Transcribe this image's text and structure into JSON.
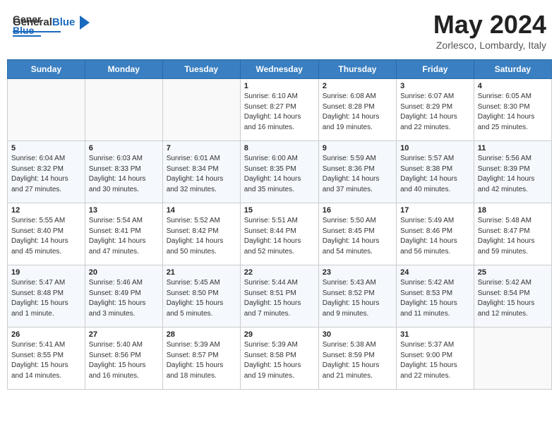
{
  "header": {
    "logo_general": "General",
    "logo_blue": "Blue",
    "title": "May 2024",
    "location": "Zorlesco, Lombardy, Italy"
  },
  "calendar": {
    "days_of_week": [
      "Sunday",
      "Monday",
      "Tuesday",
      "Wednesday",
      "Thursday",
      "Friday",
      "Saturday"
    ],
    "weeks": [
      [
        {
          "day": "",
          "info": ""
        },
        {
          "day": "",
          "info": ""
        },
        {
          "day": "",
          "info": ""
        },
        {
          "day": "1",
          "info": "Sunrise: 6:10 AM\nSunset: 8:27 PM\nDaylight: 14 hours\nand 16 minutes."
        },
        {
          "day": "2",
          "info": "Sunrise: 6:08 AM\nSunset: 8:28 PM\nDaylight: 14 hours\nand 19 minutes."
        },
        {
          "day": "3",
          "info": "Sunrise: 6:07 AM\nSunset: 8:29 PM\nDaylight: 14 hours\nand 22 minutes."
        },
        {
          "day": "4",
          "info": "Sunrise: 6:05 AM\nSunset: 8:30 PM\nDaylight: 14 hours\nand 25 minutes."
        }
      ],
      [
        {
          "day": "5",
          "info": "Sunrise: 6:04 AM\nSunset: 8:32 PM\nDaylight: 14 hours\nand 27 minutes."
        },
        {
          "day": "6",
          "info": "Sunrise: 6:03 AM\nSunset: 8:33 PM\nDaylight: 14 hours\nand 30 minutes."
        },
        {
          "day": "7",
          "info": "Sunrise: 6:01 AM\nSunset: 8:34 PM\nDaylight: 14 hours\nand 32 minutes."
        },
        {
          "day": "8",
          "info": "Sunrise: 6:00 AM\nSunset: 8:35 PM\nDaylight: 14 hours\nand 35 minutes."
        },
        {
          "day": "9",
          "info": "Sunrise: 5:59 AM\nSunset: 8:36 PM\nDaylight: 14 hours\nand 37 minutes."
        },
        {
          "day": "10",
          "info": "Sunrise: 5:57 AM\nSunset: 8:38 PM\nDaylight: 14 hours\nand 40 minutes."
        },
        {
          "day": "11",
          "info": "Sunrise: 5:56 AM\nSunset: 8:39 PM\nDaylight: 14 hours\nand 42 minutes."
        }
      ],
      [
        {
          "day": "12",
          "info": "Sunrise: 5:55 AM\nSunset: 8:40 PM\nDaylight: 14 hours\nand 45 minutes."
        },
        {
          "day": "13",
          "info": "Sunrise: 5:54 AM\nSunset: 8:41 PM\nDaylight: 14 hours\nand 47 minutes."
        },
        {
          "day": "14",
          "info": "Sunrise: 5:52 AM\nSunset: 8:42 PM\nDaylight: 14 hours\nand 50 minutes."
        },
        {
          "day": "15",
          "info": "Sunrise: 5:51 AM\nSunset: 8:44 PM\nDaylight: 14 hours\nand 52 minutes."
        },
        {
          "day": "16",
          "info": "Sunrise: 5:50 AM\nSunset: 8:45 PM\nDaylight: 14 hours\nand 54 minutes."
        },
        {
          "day": "17",
          "info": "Sunrise: 5:49 AM\nSunset: 8:46 PM\nDaylight: 14 hours\nand 56 minutes."
        },
        {
          "day": "18",
          "info": "Sunrise: 5:48 AM\nSunset: 8:47 PM\nDaylight: 14 hours\nand 59 minutes."
        }
      ],
      [
        {
          "day": "19",
          "info": "Sunrise: 5:47 AM\nSunset: 8:48 PM\nDaylight: 15 hours\nand 1 minute."
        },
        {
          "day": "20",
          "info": "Sunrise: 5:46 AM\nSunset: 8:49 PM\nDaylight: 15 hours\nand 3 minutes."
        },
        {
          "day": "21",
          "info": "Sunrise: 5:45 AM\nSunset: 8:50 PM\nDaylight: 15 hours\nand 5 minutes."
        },
        {
          "day": "22",
          "info": "Sunrise: 5:44 AM\nSunset: 8:51 PM\nDaylight: 15 hours\nand 7 minutes."
        },
        {
          "day": "23",
          "info": "Sunrise: 5:43 AM\nSunset: 8:52 PM\nDaylight: 15 hours\nand 9 minutes."
        },
        {
          "day": "24",
          "info": "Sunrise: 5:42 AM\nSunset: 8:53 PM\nDaylight: 15 hours\nand 11 minutes."
        },
        {
          "day": "25",
          "info": "Sunrise: 5:42 AM\nSunset: 8:54 PM\nDaylight: 15 hours\nand 12 minutes."
        }
      ],
      [
        {
          "day": "26",
          "info": "Sunrise: 5:41 AM\nSunset: 8:55 PM\nDaylight: 15 hours\nand 14 minutes."
        },
        {
          "day": "27",
          "info": "Sunrise: 5:40 AM\nSunset: 8:56 PM\nDaylight: 15 hours\nand 16 minutes."
        },
        {
          "day": "28",
          "info": "Sunrise: 5:39 AM\nSunset: 8:57 PM\nDaylight: 15 hours\nand 18 minutes."
        },
        {
          "day": "29",
          "info": "Sunrise: 5:39 AM\nSunset: 8:58 PM\nDaylight: 15 hours\nand 19 minutes."
        },
        {
          "day": "30",
          "info": "Sunrise: 5:38 AM\nSunset: 8:59 PM\nDaylight: 15 hours\nand 21 minutes."
        },
        {
          "day": "31",
          "info": "Sunrise: 5:37 AM\nSunset: 9:00 PM\nDaylight: 15 hours\nand 22 minutes."
        },
        {
          "day": "",
          "info": ""
        }
      ]
    ]
  }
}
